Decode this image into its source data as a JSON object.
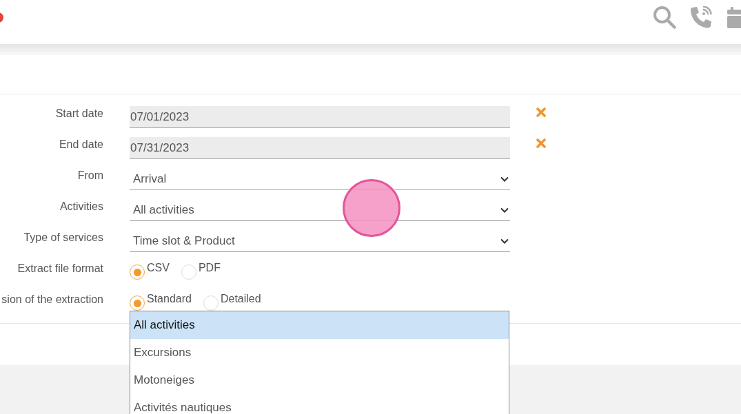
{
  "form": {
    "fields": [
      {
        "kind": "date",
        "label": "Start date",
        "value": "07/01/2023"
      },
      {
        "kind": "date",
        "label": "End date",
        "value": "07/31/2023"
      },
      {
        "kind": "select",
        "label": "From",
        "value": "Arrival",
        "focused": true
      },
      {
        "kind": "select",
        "label": "Activities",
        "value": "All activities",
        "focused": false
      },
      {
        "kind": "select",
        "label": "Type of services",
        "value": "Time slot & Product",
        "focused": false
      },
      {
        "kind": "radio",
        "label": "Extract file format",
        "options": [
          {
            "label": "CSV",
            "selected": true
          },
          {
            "label": "PDF",
            "selected": false
          }
        ]
      },
      {
        "kind": "radio",
        "label": "sion of the extraction",
        "options": [
          {
            "label": "Standard",
            "selected": true
          },
          {
            "label": "Detailed",
            "selected": false
          }
        ]
      }
    ]
  },
  "dropdown_list": {
    "options": [
      {
        "label": "All activities",
        "selected": true
      },
      {
        "label": "Excursions",
        "selected": false
      },
      {
        "label": "Motoneiges",
        "selected": false
      },
      {
        "label": "Activités nautiques",
        "selected": false
      }
    ]
  }
}
